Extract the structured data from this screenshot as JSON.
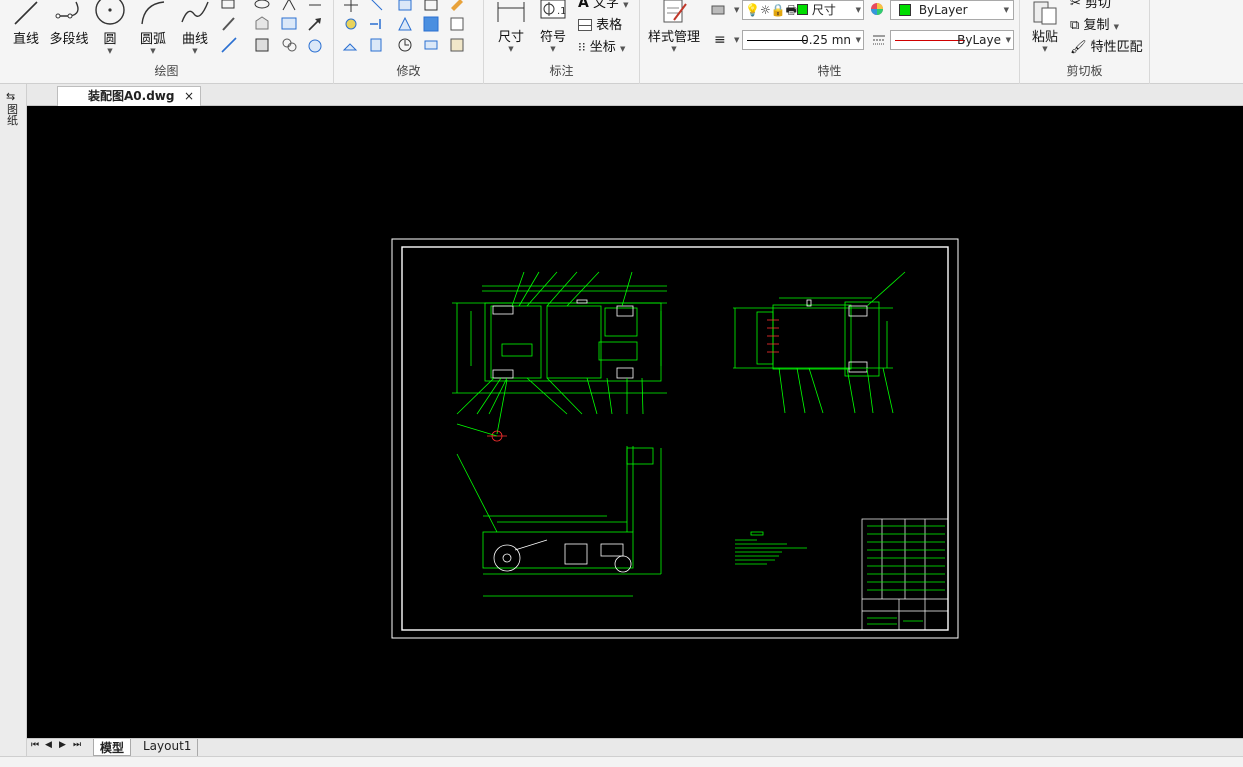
{
  "ribbon": {
    "draw": {
      "label": "绘图",
      "tools": [
        {
          "label": "直线",
          "icon": "line-icon"
        },
        {
          "label": "多段线",
          "icon": "polyline-icon"
        },
        {
          "label": "圆",
          "icon": "circle-icon"
        },
        {
          "label": "圆弧",
          "icon": "arc-icon"
        },
        {
          "label": "曲线",
          "icon": "spline-icon"
        }
      ]
    },
    "modify": {
      "label": "修改"
    },
    "annotate": {
      "label": "标注",
      "dimension": "尺寸",
      "symbol": "符号",
      "text": "文字",
      "table": "表格",
      "coordinate": "坐标"
    },
    "properties": {
      "label": "特性",
      "style_manager": "样式管理",
      "layer_state": "尺寸",
      "lineweight": "0.25 mn",
      "color": "ByLayer",
      "linetype": "ByLaye",
      "color_swatch": "#00dd00",
      "linetype_color": "#d00000"
    },
    "clipboard": {
      "label": "剪切板",
      "paste": "粘贴",
      "cut": "剪切",
      "copy": "复制",
      "match": "特性匹配"
    }
  },
  "doc_tab": {
    "title": "装配图A0.dwg",
    "close": "×"
  },
  "left_strip": {
    "label": "图纸"
  },
  "layout_tabs": {
    "model": "模型",
    "layout1": "Layout1"
  },
  "colors": {
    "drawing_green": "#00ff00",
    "frame_white": "#ffffff",
    "canvas": "#000000",
    "accent_red": "#ff2020"
  }
}
